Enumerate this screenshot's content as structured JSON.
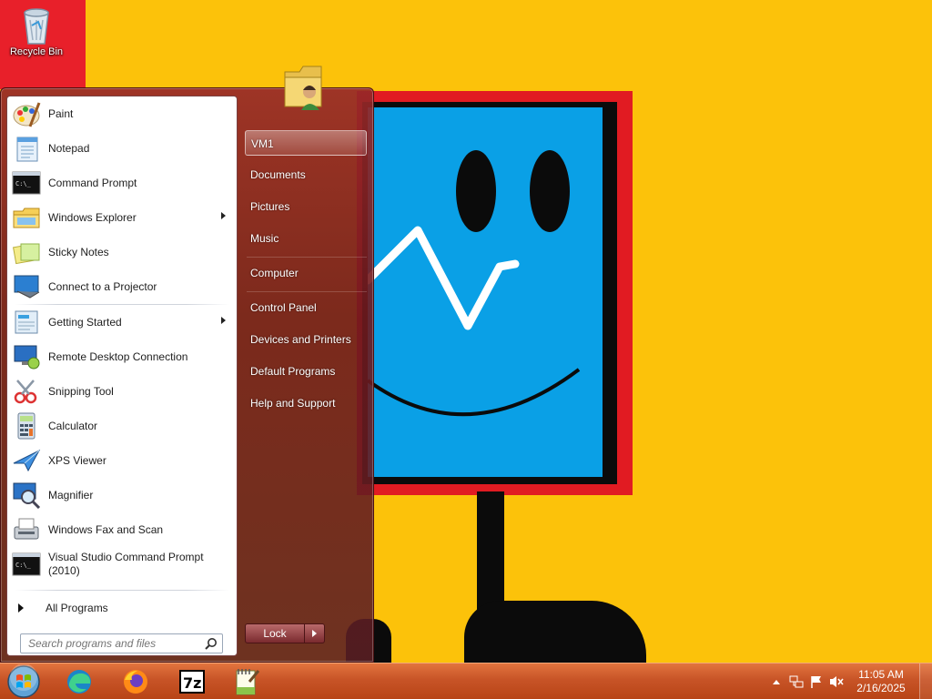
{
  "desktop": {
    "icons": [
      {
        "label": "Recycle Bin",
        "icon": "recycle-bin-icon"
      }
    ]
  },
  "start_menu": {
    "programs": [
      {
        "label": "Paint",
        "icon": "paint-icon",
        "submenu": false
      },
      {
        "label": "Notepad",
        "icon": "notepad-icon",
        "submenu": false
      },
      {
        "label": "Command Prompt",
        "icon": "command-prompt-icon",
        "submenu": false
      },
      {
        "label": "Windows Explorer",
        "icon": "windows-explorer-icon",
        "submenu": true
      },
      {
        "label": "Sticky Notes",
        "icon": "sticky-notes-icon",
        "submenu": false
      },
      {
        "label": "Connect to a Projector",
        "icon": "projector-icon",
        "submenu": false
      },
      {
        "label": "Getting Started",
        "icon": "getting-started-icon",
        "submenu": true
      },
      {
        "label": "Remote Desktop Connection",
        "icon": "remote-desktop-icon",
        "submenu": false
      },
      {
        "label": "Snipping Tool",
        "icon": "snipping-tool-icon",
        "submenu": false
      },
      {
        "label": "Calculator",
        "icon": "calculator-icon",
        "submenu": false
      },
      {
        "label": "XPS Viewer",
        "icon": "xps-viewer-icon",
        "submenu": false
      },
      {
        "label": "Magnifier",
        "icon": "magnifier-icon",
        "submenu": false
      },
      {
        "label": "Windows Fax and Scan",
        "icon": "fax-scan-icon",
        "submenu": false
      },
      {
        "label": "Visual Studio Command Prompt",
        "label2": "(2010)",
        "icon": "vs-command-prompt-icon",
        "submenu": false
      }
    ],
    "all_programs": "All Programs",
    "search_placeholder": "Search programs and files",
    "right_items": [
      {
        "label": "VM1"
      },
      {
        "label": "Documents"
      },
      {
        "label": "Pictures"
      },
      {
        "label": "Music"
      },
      {
        "label": "Computer"
      },
      {
        "label": "Control Panel"
      },
      {
        "label": "Devices and Printers"
      },
      {
        "label": "Default Programs"
      },
      {
        "label": "Help and Support"
      }
    ],
    "lock_label": "Lock"
  },
  "taskbar": {
    "pinned": [
      {
        "name": "Edge",
        "icon": "edge-icon"
      },
      {
        "name": "Firefox",
        "icon": "firefox-icon"
      },
      {
        "name": "7-Zip",
        "icon": "7zip-icon"
      },
      {
        "name": "Notepad++",
        "icon": "notepadpp-icon"
      }
    ],
    "tray_icons": [
      "show-hidden-icons-icon",
      "network-icon",
      "action-center-flag-icon",
      "volume-muted-icon"
    ],
    "time": "11:05 AM",
    "date": "2/16/2025"
  }
}
